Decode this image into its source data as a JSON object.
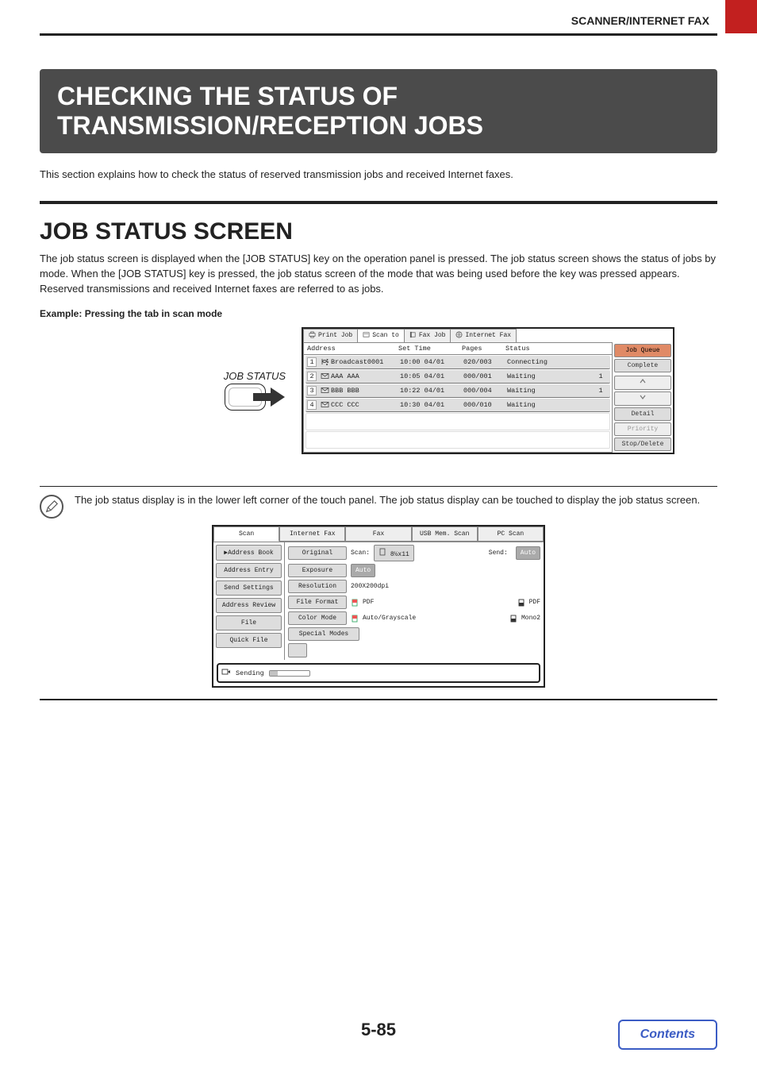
{
  "header": {
    "section_title": "SCANNER/INTERNET FAX"
  },
  "banner": {
    "title_line1": "CHECKING THE STATUS OF",
    "title_line2": "TRANSMISSION/RECEPTION JOBS"
  },
  "intro_text": "This section explains how to check the status of reserved transmission jobs and received Internet faxes.",
  "h2_title": "JOB STATUS SCREEN",
  "h2_body": "The job status screen is displayed when the [JOB STATUS] key on the operation panel is pressed. The job status screen shows the status of jobs by mode. When the [JOB STATUS] key is pressed, the job status screen of the mode that was being used before the key was pressed appears.\nReserved transmissions and received Internet faxes are referred to as jobs.",
  "example_label": "Example: Pressing the tab in scan mode",
  "cue_label": "JOB STATUS",
  "job_status_panel": {
    "tabs": [
      {
        "label": "Print Job",
        "icon": "printer-icon"
      },
      {
        "label": "Scan to",
        "icon": "scan-icon"
      },
      {
        "label": "Fax Job",
        "icon": "fax-icon"
      },
      {
        "label": "Internet Fax",
        "icon": "globe-icon"
      }
    ],
    "columns": {
      "address": "Address",
      "set_time": "Set Time",
      "pages": "Pages",
      "status": "Status"
    },
    "rows": [
      {
        "idx": "1",
        "icon": "broadcast-icon",
        "address": "Broadcast0001",
        "time": "10:00 04/01",
        "pages": "020/003",
        "status": "Connecting",
        "set": ""
      },
      {
        "idx": "2",
        "icon": "mail-icon",
        "address": "AAA AAA",
        "time": "10:05 04/01",
        "pages": "000/001",
        "status": "Waiting",
        "set": "1"
      },
      {
        "idx": "3",
        "icon": "mail-icon",
        "address": "BBB BBB",
        "time": "10:22 04/01",
        "pages": "000/004",
        "status": "Waiting",
        "set": "1"
      },
      {
        "idx": "4",
        "icon": "mail-icon",
        "address": "CCC CCC",
        "time": "10:30 04/01",
        "pages": "000/010",
        "status": "Waiting",
        "set": ""
      }
    ],
    "side": {
      "job_queue": "Job Queue",
      "complete": "Complete",
      "detail": "Detail",
      "priority": "Priority",
      "stop_delete": "Stop/Delete"
    }
  },
  "note_text": "The job status display is in the lower left corner of the touch panel. The job status display can be touched to display the job status screen.",
  "ops_panel": {
    "tabs": [
      "Scan",
      "Internet Fax",
      "Fax",
      "USB Mem. Scan",
      "PC Scan"
    ],
    "left_buttons": [
      "Address Book",
      "Address Entry",
      "Send Settings",
      "Address Review",
      "File",
      "Quick File"
    ],
    "rows": {
      "original": {
        "label": "Original",
        "mid_label": "Scan:",
        "mid_val": "8½x11",
        "send_label": "Send:",
        "send_val": "Auto"
      },
      "exposure": {
        "label": "Exposure",
        "val": "Auto"
      },
      "resolution": {
        "label": "Resolution",
        "val": "200X200dpi"
      },
      "file_format": {
        "label": "File Format",
        "val1": "PDF",
        "val2": "PDF"
      },
      "color_mode": {
        "label": "Color Mode",
        "val1": "Auto/Grayscale",
        "val2": "Mono2"
      },
      "special": {
        "label": "Special Modes"
      }
    },
    "status_label": "Sending"
  },
  "page_number": "5-85",
  "contents_label": "Contents"
}
